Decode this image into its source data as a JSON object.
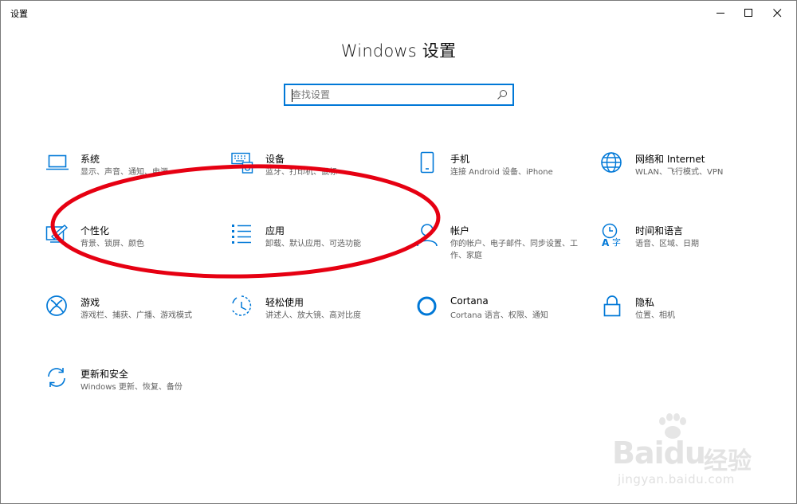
{
  "window": {
    "title": "设置",
    "controls": {
      "minimize": "minimize",
      "maximize": "maximize",
      "close": "close"
    }
  },
  "header": {
    "title": "Windows 设置"
  },
  "search": {
    "placeholder": "查找设置"
  },
  "categories": [
    {
      "name": "系统",
      "desc": "显示、声音、通知、电源",
      "icon": "laptop-icon"
    },
    {
      "name": "设备",
      "desc": "蓝牙、打印机、鼠标",
      "icon": "keyboard-printer-icon"
    },
    {
      "name": "手机",
      "desc": "连接 Android 设备、iPhone",
      "icon": "phone-icon"
    },
    {
      "name": "网络和 Internet",
      "desc": "WLAN、飞行模式、VPN",
      "icon": "globe-icon"
    },
    {
      "name": "个性化",
      "desc": "背景、锁屏、颜色",
      "icon": "paint-icon"
    },
    {
      "name": "应用",
      "desc": "卸载、默认应用、可选功能",
      "icon": "apps-list-icon"
    },
    {
      "name": "帐户",
      "desc": "你的帐户、电子邮件、同步设置、工作、家庭",
      "icon": "person-icon"
    },
    {
      "name": "时间和语言",
      "desc": "语音、区域、日期",
      "icon": "time-language-icon"
    },
    {
      "name": "游戏",
      "desc": "游戏栏、捕获、广播、游戏模式",
      "icon": "xbox-icon"
    },
    {
      "name": "轻松使用",
      "desc": "讲述人、放大镜、高对比度",
      "icon": "ease-of-access-icon"
    },
    {
      "name": "Cortana",
      "desc": "Cortana 语言、权限、通知",
      "icon": "cortana-icon"
    },
    {
      "name": "隐私",
      "desc": "位置、相机",
      "icon": "lock-icon"
    },
    {
      "name": "更新和安全",
      "desc": "Windows 更新、恢复、备份",
      "icon": "sync-icon"
    }
  ],
  "annotation": {
    "shape": "ellipse",
    "color": "#e60012"
  },
  "watermark": {
    "brand": "Bai",
    "brand2": "du",
    "brand_cn": "经验",
    "url": "jingyan.baidu.com"
  },
  "colors": {
    "accent": "#0078d7",
    "annotation": "#e60012"
  }
}
